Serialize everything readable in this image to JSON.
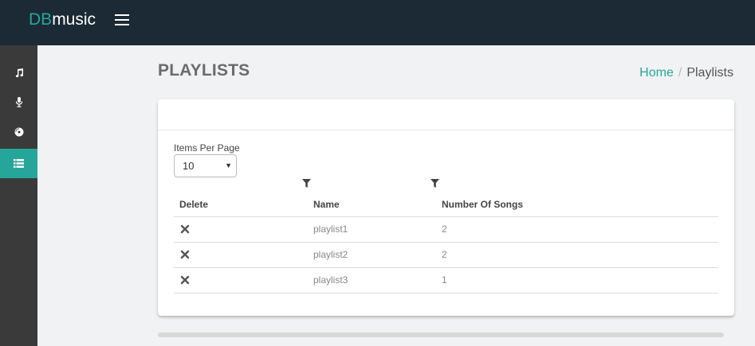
{
  "app": {
    "brand_prefix": "DB",
    "brand_suffix": "music"
  },
  "sidebar": {
    "items": [
      {
        "icon": "music-icon",
        "active": false
      },
      {
        "icon": "microphone-icon",
        "active": false
      },
      {
        "icon": "disc-icon",
        "active": false
      },
      {
        "icon": "list-icon",
        "active": true
      }
    ]
  },
  "page": {
    "title": "PLAYLISTS"
  },
  "breadcrumb": {
    "home": "Home",
    "separator": "/",
    "current": "Playlists"
  },
  "pagination": {
    "label": "Items Per Page",
    "value": "10"
  },
  "table": {
    "columns": [
      "Delete",
      "Name",
      "Number Of Songs"
    ],
    "rows": [
      {
        "name": "playlist1",
        "songs": "2"
      },
      {
        "name": "playlist2",
        "songs": "2"
      },
      {
        "name": "playlist3",
        "songs": "1"
      }
    ]
  },
  "colors": {
    "accent": "#26a69a",
    "topbar": "#1b2a35",
    "sidebar": "#3a3a3a"
  }
}
